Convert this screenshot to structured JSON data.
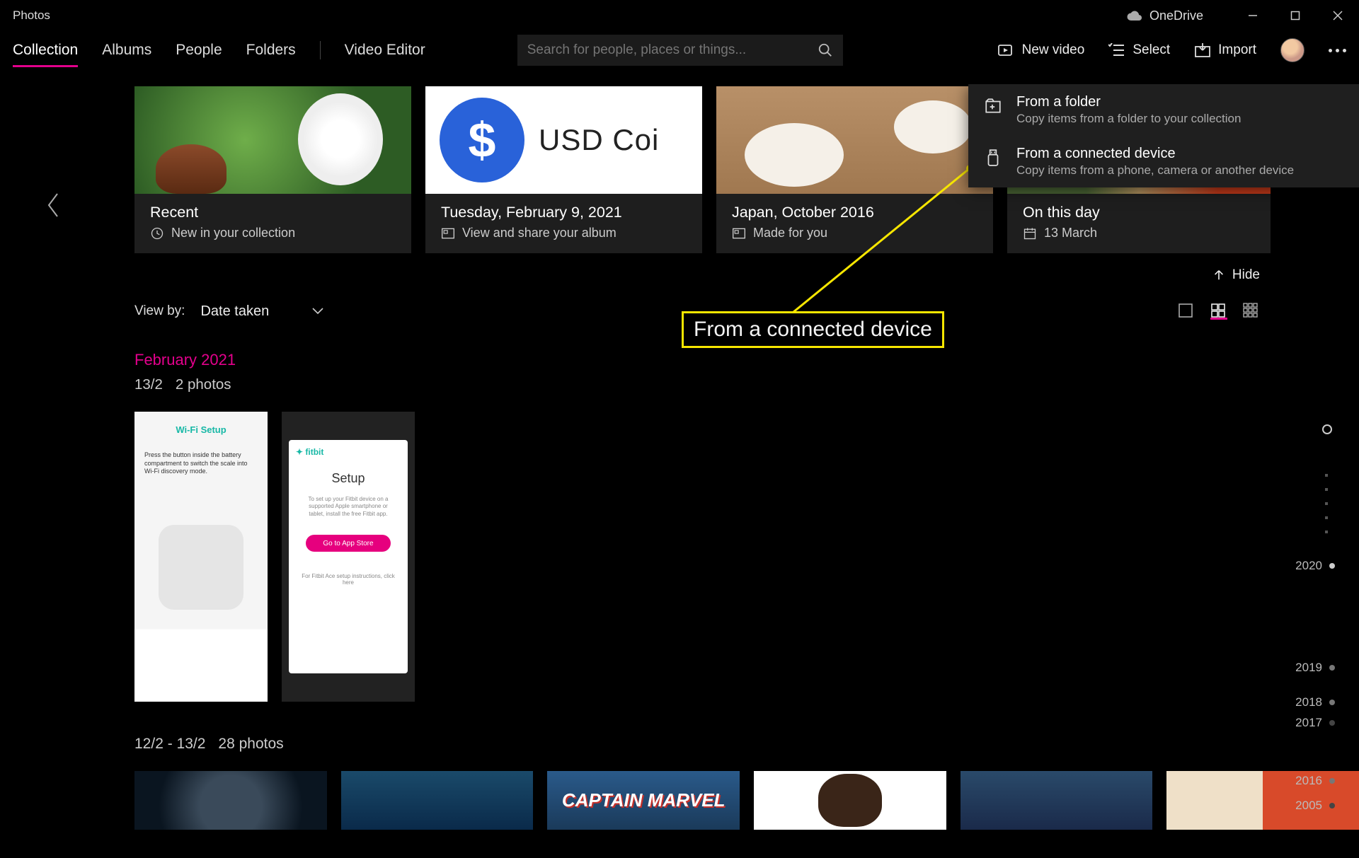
{
  "titlebar": {
    "app_title": "Photos",
    "onedrive_label": "OneDrive"
  },
  "nav": {
    "tabs": [
      "Collection",
      "Albums",
      "People",
      "Folders",
      "Video Editor"
    ],
    "active_tab_index": 0
  },
  "search": {
    "placeholder": "Search for people, places or things..."
  },
  "toolbar": {
    "new_video": "New video",
    "select": "Select",
    "import": "Import"
  },
  "import_menu": {
    "items": [
      {
        "title": "From a folder",
        "desc": "Copy items from a folder to your collection",
        "icon": "folder-add-icon"
      },
      {
        "title": "From a connected device",
        "desc": "Copy items from a phone, camera or another device",
        "icon": "usb-device-icon"
      }
    ]
  },
  "cards": [
    {
      "title": "Recent",
      "subtitle": "New in your collection",
      "sub_icon": "clock-icon"
    },
    {
      "title": "Tuesday, February 9, 2021",
      "subtitle": "View and share your album",
      "sub_icon": "album-icon"
    },
    {
      "title": "Japan, October 2016",
      "subtitle": "Made for you",
      "sub_icon": "album-icon"
    },
    {
      "title": "On this day",
      "subtitle": "13 March",
      "sub_icon": "calendar-icon"
    }
  ],
  "hide_label": "Hide",
  "view_by": {
    "label": "View by:",
    "selected": "Date taken"
  },
  "groups": [
    {
      "month": "February 2021",
      "date": "13/2",
      "count_label": "2 photos"
    },
    {
      "date_range": "12/2 - 13/2",
      "count_label": "28 photos"
    }
  ],
  "thumb1": {
    "header": "Wi-Fi Setup",
    "text": "Press the button inside the battery compartment to switch the scale into Wi-Fi discovery mode."
  },
  "thumb2": {
    "logo": "fitbit",
    "title": "Setup",
    "desc": "To set up your Fitbit device on a supported Apple smartphone or tablet, install the free Fitbit app.",
    "button": "Go to App Store",
    "footer": "For Fitbit Ace setup instructions, click here"
  },
  "captain_marvel": "CAPTAIN MARVEL",
  "timeline_years": [
    "2020",
    "2019",
    "2018",
    "2017",
    "2016",
    "2005"
  ],
  "callout": "From a connected device"
}
